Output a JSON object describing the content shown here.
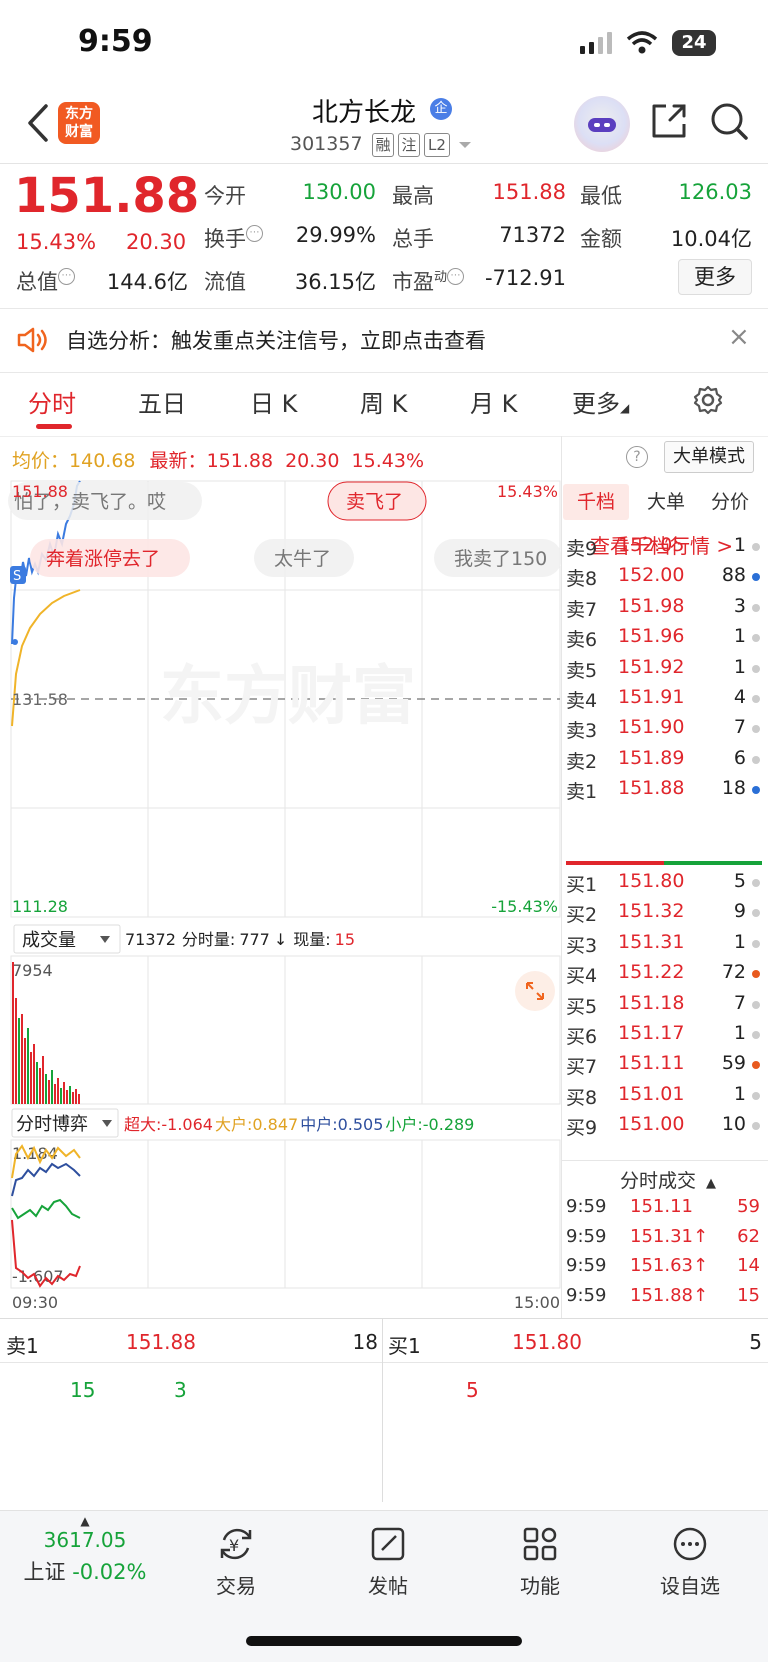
{
  "status": {
    "time": "9:59",
    "battery": "24"
  },
  "header": {
    "name": "北方长龙",
    "verified_badge": "企",
    "code": "301357",
    "tags": [
      "融",
      "注",
      "L2"
    ],
    "logo_text": [
      "东方",
      "财富"
    ]
  },
  "quote": {
    "price": "151.88",
    "pct": "15.43%",
    "change": "20.30",
    "open_label": "今开",
    "open": "130.00",
    "high_label": "最高",
    "high": "151.88",
    "low_label": "最低",
    "low": "126.03",
    "turnover_label": "换手",
    "turnover": "29.99%",
    "volume_label": "总手",
    "volume": "71372",
    "amount_label": "金额",
    "amount": "10.04亿",
    "mktcap_label": "总值",
    "mktcap": "144.6亿",
    "float_label": "流值",
    "float_cap": "36.15亿",
    "pe_label": "市盈",
    "pe_sup": "动",
    "pe": "-712.91",
    "more": "更多"
  },
  "alert": {
    "text": "自选分析：触发重点关注信号，立即点击查看"
  },
  "tabs": [
    "分时",
    "五日",
    "日 K",
    "周 K",
    "月 K",
    "更多"
  ],
  "chart_info": {
    "avg_label": "均价：",
    "avg": "140.68",
    "latest_label": "最新：",
    "latest": "151.88",
    "change": "20.30",
    "pct": "15.43%",
    "big_mode": "大单模式"
  },
  "chart_data": {
    "type": "line",
    "price_axis": {
      "max": "151.88",
      "prev_close": "131.58",
      "min": "111.28",
      "max_pct": "15.43%",
      "min_pct": "-15.43%"
    },
    "time_axis": {
      "start": "09:30",
      "end": "15:00"
    },
    "danmaku": [
      "怕了，卖飞了。哎",
      "卖飞了",
      "奔着涨停去了",
      "太牛了",
      "我卖了150"
    ],
    "watermark": "东方财富",
    "volume_panel": {
      "selector": "成交量",
      "total": "71372",
      "minute_label": "分时量:",
      "minute": "777",
      "now_label": "现量:",
      "now": "15",
      "max": "7954"
    },
    "flow_panel": {
      "selector": "分时博弈",
      "super": "超大:-1.064",
      "large": "大户:0.847",
      "medium": "中户:0.505",
      "small": "小户:-0.289",
      "max": "1.184",
      "min": "-1.607"
    }
  },
  "orderbook": {
    "tabs": [
      "千档",
      "大单",
      "分价"
    ],
    "link": "查看千档行情 >",
    "asks": [
      {
        "label": "卖9",
        "price": "152.05",
        "vol": "1",
        "dot": "#cccccc"
      },
      {
        "label": "卖8",
        "price": "152.00",
        "vol": "88",
        "dot": "#2a6fd6"
      },
      {
        "label": "卖7",
        "price": "151.98",
        "vol": "3",
        "dot": "#cccccc"
      },
      {
        "label": "卖6",
        "price": "151.96",
        "vol": "1",
        "dot": "#cccccc"
      },
      {
        "label": "卖5",
        "price": "151.92",
        "vol": "1",
        "dot": "#cccccc"
      },
      {
        "label": "卖4",
        "price": "151.91",
        "vol": "4",
        "dot": "#cccccc"
      },
      {
        "label": "卖3",
        "price": "151.90",
        "vol": "7",
        "dot": "#cccccc"
      },
      {
        "label": "卖2",
        "price": "151.89",
        "vol": "6",
        "dot": "#cccccc"
      },
      {
        "label": "卖1",
        "price": "151.88",
        "vol": "18",
        "dot": "#2a6fd6"
      }
    ],
    "bids": [
      {
        "label": "买1",
        "price": "151.80",
        "vol": "5",
        "dot": "#cccccc"
      },
      {
        "label": "买2",
        "price": "151.32",
        "vol": "9",
        "dot": "#cccccc"
      },
      {
        "label": "买3",
        "price": "151.31",
        "vol": "1",
        "dot": "#cccccc"
      },
      {
        "label": "买4",
        "price": "151.22",
        "vol": "72",
        "dot": "#e85a1e"
      },
      {
        "label": "买5",
        "price": "151.18",
        "vol": "7",
        "dot": "#cccccc"
      },
      {
        "label": "买6",
        "price": "151.17",
        "vol": "1",
        "dot": "#cccccc"
      },
      {
        "label": "买7",
        "price": "151.11",
        "vol": "59",
        "dot": "#e85a1e"
      },
      {
        "label": "买8",
        "price": "151.01",
        "vol": "1",
        "dot": "#cccccc"
      },
      {
        "label": "买9",
        "price": "151.00",
        "vol": "10",
        "dot": "#cccccc"
      }
    ],
    "ticks_title": "分时成交",
    "ticks": [
      {
        "time": "9:59",
        "price": "151.11",
        "vol": "59"
      },
      {
        "time": "9:59",
        "price": "151.31↑",
        "vol": "62"
      },
      {
        "time": "9:59",
        "price": "151.63↑",
        "vol": "14"
      },
      {
        "time": "9:59",
        "price": "151.88↑",
        "vol": "15"
      }
    ]
  },
  "depth": {
    "sell_label": "卖1",
    "sell_price": "151.88",
    "sell_vol": "18",
    "buy_label": "买1",
    "buy_price": "151.80",
    "buy_vol": "5",
    "sell_orders": [
      "15",
      "3"
    ],
    "buy_orders": [
      "5"
    ]
  },
  "nav": {
    "index_value": "3617.05",
    "index_name": "上证",
    "index_pct": "-0.02%",
    "items": [
      "交易",
      "发帖",
      "功能",
      "设自选"
    ]
  }
}
